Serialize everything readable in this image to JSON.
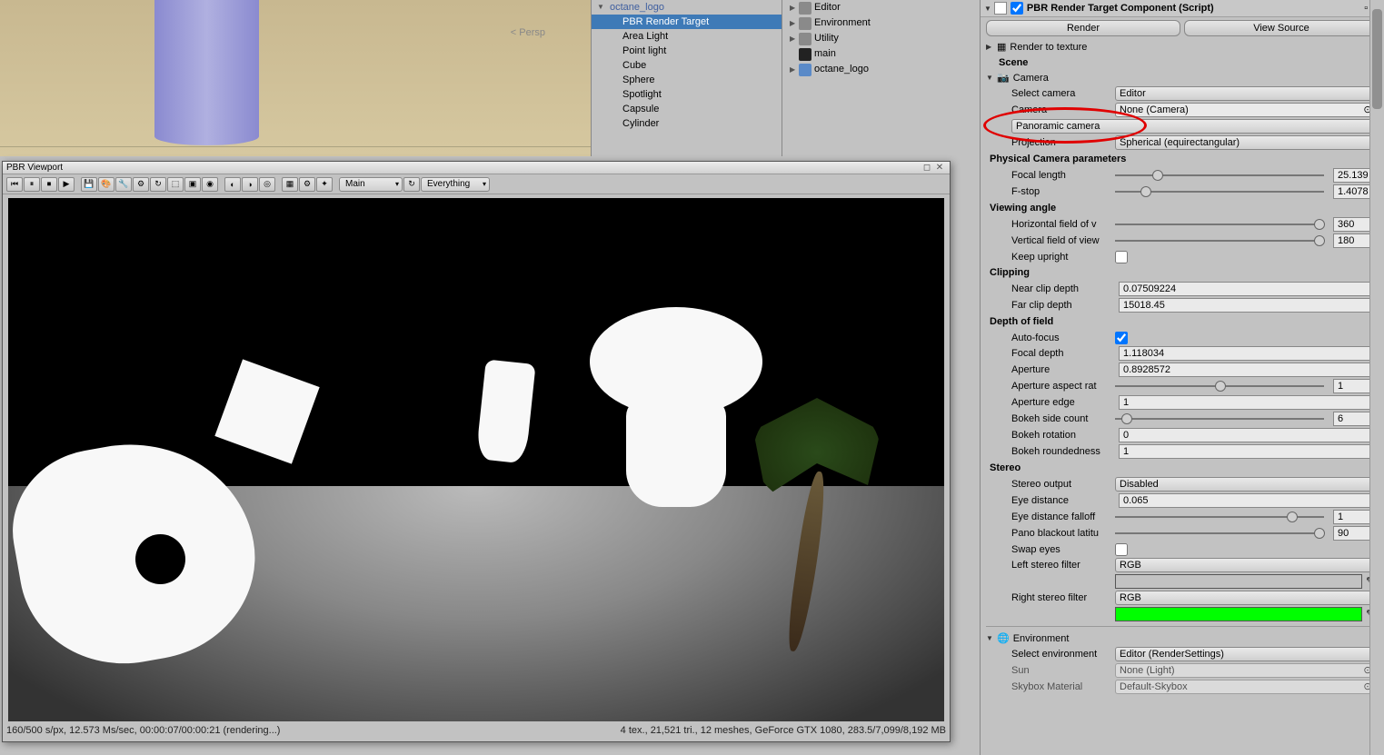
{
  "scene_view": {
    "persp_label": "< Persp"
  },
  "hierarchy": {
    "root": "octane_logo",
    "children": [
      "PBR Render Target",
      "Area Light",
      "Point light",
      "Cube",
      "Sphere",
      "Spotlight",
      "Capsule",
      "Cylinder"
    ],
    "selected": "PBR Render Target"
  },
  "project": {
    "items": [
      {
        "fold": "▶",
        "type": "folder",
        "label": "Editor"
      },
      {
        "fold": "▶",
        "type": "folder",
        "label": "Environment"
      },
      {
        "fold": "▶",
        "type": "folder",
        "label": "Utility"
      },
      {
        "fold": "",
        "type": "unity",
        "label": "main"
      },
      {
        "fold": "▶",
        "type": "prefab",
        "label": "octane_logo"
      }
    ]
  },
  "inspector": {
    "component_title": "PBR Render Target Component (Script)",
    "buttons": {
      "render": "Render",
      "view_source": "View Source"
    },
    "render_to_texture": "Render to texture",
    "scene_header": "Scene",
    "camera_header": "Camera",
    "select_camera": {
      "label": "Select camera",
      "value": "Editor"
    },
    "camera_field": {
      "label": "Camera",
      "value": "None (Camera)"
    },
    "panoramic_camera": {
      "label": "Panoramic camera"
    },
    "projection": {
      "label": "Projection",
      "value": "Spherical (equirectangular)"
    },
    "physical_header": "Physical Camera parameters",
    "focal_length": {
      "label": "Focal length",
      "value": "25.139"
    },
    "f_stop": {
      "label": "F-stop",
      "value": "1.4078"
    },
    "viewing_header": "Viewing angle",
    "horiz_fov": {
      "label": "Horizontal field of v",
      "value": "360"
    },
    "vert_fov": {
      "label": "Vertical field of view",
      "value": "180"
    },
    "keep_upright": {
      "label": "Keep upright"
    },
    "clipping_header": "Clipping",
    "near_clip": {
      "label": "Near clip depth",
      "value": "0.07509224"
    },
    "far_clip": {
      "label": "Far clip depth",
      "value": "15018.45"
    },
    "dof_header": "Depth of field",
    "auto_focus": {
      "label": "Auto-focus"
    },
    "focal_depth": {
      "label": "Focal depth",
      "value": "1.118034"
    },
    "aperture": {
      "label": "Aperture",
      "value": "0.8928572"
    },
    "aperture_ratio": {
      "label": "Aperture aspect rat",
      "value": "1"
    },
    "aperture_edge": {
      "label": "Aperture edge",
      "value": "1"
    },
    "bokeh_sides": {
      "label": "Bokeh side count",
      "value": "6"
    },
    "bokeh_rot": {
      "label": "Bokeh rotation",
      "value": "0"
    },
    "bokeh_round": {
      "label": "Bokeh roundedness",
      "value": "1"
    },
    "stereo_header": "Stereo",
    "stereo_output": {
      "label": "Stereo output",
      "value": "Disabled"
    },
    "eye_distance": {
      "label": "Eye distance",
      "value": "0.065"
    },
    "eye_falloff": {
      "label": "Eye distance falloff",
      "value": "1"
    },
    "pano_blackout": {
      "label": "Pano blackout latitu",
      "value": "90"
    },
    "swap_eyes": {
      "label": "Swap eyes"
    },
    "left_filter": {
      "label": "Left stereo filter",
      "value": "RGB",
      "color": "#ff00ff"
    },
    "right_filter": {
      "label": "Right stereo filter",
      "value": "RGB",
      "color": "#00ff00"
    },
    "environment_header": "Environment",
    "select_env": {
      "label": "Select environment",
      "value": "Editor (RenderSettings)"
    },
    "sun": {
      "label": "Sun",
      "value": "None (Light)"
    },
    "skybox": {
      "label": "Skybox Material",
      "value": "Default-Skybox"
    }
  },
  "viewport": {
    "title": "PBR Viewport",
    "camera_dropdown": "Main",
    "layers_dropdown": "Everything",
    "status_left": "160/500 s/px, 12.573 Ms/sec, 00:00:07/00:00:21 (rendering...)",
    "status_right": "4 tex., 21,521 tri., 12 meshes, GeForce GTX 1080, 283.5/7,099/8,192 MB"
  }
}
